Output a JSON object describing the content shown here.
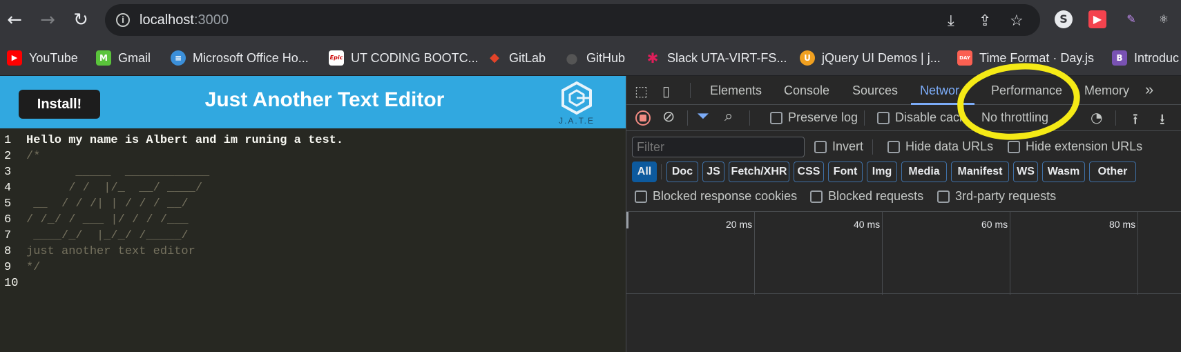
{
  "browser": {
    "url_host": "localhost",
    "url_port": ":3000",
    "nav": {
      "back": "←",
      "forward": "→",
      "reload": "↻"
    },
    "omni_icons": [
      "download-icon",
      "share-icon",
      "star-icon"
    ],
    "extensions": [
      "S",
      "▶",
      "✎",
      "⚛"
    ]
  },
  "bookmarks": [
    {
      "label": "YouTube",
      "icon": "youtube-icon",
      "color": "#ff0000",
      "glyph": "▶"
    },
    {
      "label": "Gmail",
      "icon": "gmail-icon",
      "color": "#5ac43b",
      "glyph": "M"
    },
    {
      "label": "Microsoft Office Ho...",
      "icon": "database-icon",
      "color": "#3b8fd9",
      "glyph": "≡"
    },
    {
      "label": "UT CODING BOOTC...",
      "icon": "epic-icon",
      "color": "#ffffff",
      "glyph": "Epic"
    },
    {
      "label": "GitLab",
      "icon": "gitlab-icon",
      "color": "#e24329",
      "glyph": "◆"
    },
    {
      "label": "GitHub",
      "icon": "github-icon",
      "color": "#333333",
      "glyph": "●"
    },
    {
      "label": "Slack  UTA-VIRT-FS...",
      "icon": "slack-icon",
      "color": "#4a154b",
      "glyph": "✱"
    },
    {
      "label": "jQuery UI Demos | j...",
      "icon": "jquery-icon",
      "color": "#f0a020",
      "glyph": "U"
    },
    {
      "label": "Time Format · Day.js",
      "icon": "dayjs-icon",
      "color": "#fb6052",
      "glyph": "D"
    },
    {
      "label": "Introduc",
      "icon": "bootstrap-icon",
      "color": "#7952b3",
      "glyph": "B"
    }
  ],
  "app": {
    "install_label": "Install!",
    "title": "Just Another Text Editor",
    "logo_text": "J.A.T.E",
    "accent": "#31a8e0"
  },
  "editor": {
    "lines": [
      {
        "n": "1",
        "text": "Hello my name is Albert and im runing a test.",
        "bold": true
      },
      {
        "n": "2",
        "text": "/*",
        "bold": false
      },
      {
        "n": "3",
        "text": "       _____  ____________",
        "bold": false
      },
      {
        "n": "4",
        "text": "      / /  |/_  __/ ____/",
        "bold": false
      },
      {
        "n": "5",
        "text": " __  / / /| | / / / __/",
        "bold": false
      },
      {
        "n": "6",
        "text": "/ /_/ / ___ |/ / / /___",
        "bold": false
      },
      {
        "n": "7",
        "text": " ____/_/  |_/_/ /_____/",
        "bold": false
      },
      {
        "n": "8",
        "text": "just another text editor",
        "bold": false
      },
      {
        "n": "9",
        "text": "*/",
        "bold": false
      },
      {
        "n": "10",
        "text": "",
        "bold": false
      }
    ]
  },
  "devtools": {
    "tabs": [
      "Elements",
      "Console",
      "Sources",
      "Network",
      "Performance",
      "Memory"
    ],
    "active_tab": "Network",
    "network_tab_visible": "Networ",
    "more": "»",
    "preserve_log": "Preserve log",
    "disable_cache": "Disable cache",
    "throttling": "No throttling",
    "filter_placeholder": "Filter",
    "invert": "Invert",
    "hide_data_urls": "Hide data URLs",
    "hide_ext_urls": "Hide extension URLs",
    "types": [
      "All",
      "Doc",
      "JS",
      "Fetch/XHR",
      "CSS",
      "Font",
      "Img",
      "Media",
      "Manifest",
      "WS",
      "Wasm",
      "Other"
    ],
    "blocked_cookies": "Blocked response cookies",
    "blocked_requests": "Blocked requests",
    "third_party": "3rd-party requests",
    "timeline_labels": [
      "20 ms",
      "40 ms",
      "60 ms",
      "80 ms"
    ]
  },
  "annotation_color": "#f5ea16"
}
